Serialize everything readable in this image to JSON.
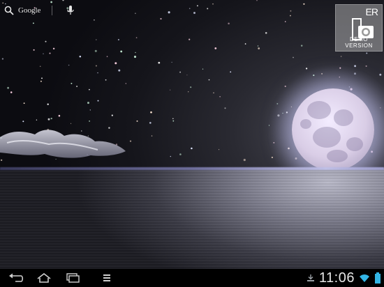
{
  "search_bar": {
    "label": "Google",
    "search_icon": "search-icon",
    "mic_icon": "mic-icon"
  },
  "watermark": {
    "letters": "ER",
    "text": "DEMO VERSION"
  },
  "wallpaper": {
    "scene": "moon-over-sea"
  },
  "nav": {
    "buttons": [
      {
        "name": "back",
        "icon": "back-icon"
      },
      {
        "name": "home",
        "icon": "home-icon"
      },
      {
        "name": "recent-apps",
        "icon": "recent-apps-icon"
      },
      {
        "name": "menu",
        "icon": "menu-icon"
      }
    ]
  },
  "status": {
    "notification_icon": "download-icon",
    "wifi_icon": "wifi-icon",
    "battery_icon": "battery-icon",
    "time": "11:06"
  },
  "colors": {
    "accent": "#33b5e5",
    "sky": "#15151b",
    "moon": "#e6ddf0"
  }
}
